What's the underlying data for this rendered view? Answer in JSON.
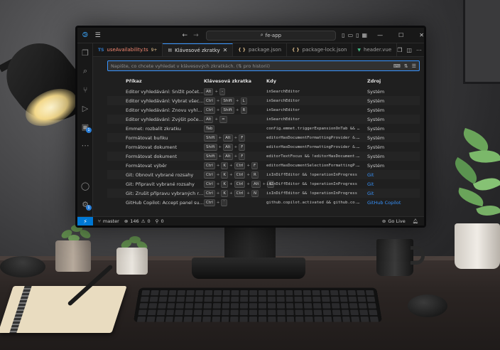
{
  "titlebar": {
    "search_text": "fe-app",
    "search_icon": "search-icon"
  },
  "tabs": [
    {
      "label": "useAvailability.ts",
      "icon": "TS",
      "icon_color": "#3178c6",
      "modified": "9+",
      "active": false,
      "color": "#f48771"
    },
    {
      "label": "Klávesové zkratky",
      "icon": "keyboard-icon",
      "active": true
    },
    {
      "label": "package.json",
      "icon": "{ }",
      "icon_color": "#e2c08d",
      "active": false
    },
    {
      "label": "package-lock.json",
      "icon": "{ }",
      "icon_color": "#e2c08d",
      "active": false
    },
    {
      "label": "header.vue",
      "icon": "vue-icon",
      "icon_color": "#42b883",
      "active": false
    }
  ],
  "keybindings": {
    "search_placeholder": "Napište, co chcete vyhledat v klávesových zkratkách. (⇅ pro historii)",
    "columns": {
      "command": "Příkaz",
      "keybinding": "Klávesová zkratka",
      "when": "Kdy",
      "source": "Zdroj"
    },
    "rows": [
      {
        "command": "Editor vyhledávání: Snížit počet řádků k...",
        "keys": [
          "Alt",
          "-"
        ],
        "when": "inSearchEditor",
        "source": "Systém",
        "ext": false
      },
      {
        "command": "Editor vyhledávání: Vybrat všechny shody",
        "keys": [
          "Ctrl",
          "Shift",
          "L"
        ],
        "when": "inSearchEditor",
        "source": "Systém",
        "ext": false
      },
      {
        "command": "Editor vyhledávání: Znovu vyhledat",
        "keys": [
          "Ctrl",
          "Shift",
          "R"
        ],
        "when": "inSearchEditor",
        "source": "Systém",
        "ext": false
      },
      {
        "command": "Editor vyhledávání: Zvýšit počet řádků k...",
        "keys": [
          "Alt",
          "="
        ],
        "when": "inSearchEditor",
        "source": "Systém",
        "ext": false
      },
      {
        "command": "Emmet: rozbalit zkratku",
        "keys": [
          "Tab"
        ],
        "when": "config.emmet.triggerExpansionOnTab && ...",
        "source": "Systém",
        "ext": false
      },
      {
        "command": "Formátovat buňku",
        "keys": [
          "Shift",
          "Alt",
          "F"
        ],
        "when": "editorHasDocumentFormattingProvider &...",
        "source": "Systém",
        "ext": false
      },
      {
        "command": "Formátovat dokument",
        "keys": [
          "Shift",
          "Alt",
          "F"
        ],
        "when": "editorHasDocumentFormattingProvider &...",
        "source": "Systém",
        "ext": false
      },
      {
        "command": "Formátovat dokument",
        "keys": [
          "Shift",
          "Alt",
          "F"
        ],
        "when": "editorTextFocus && !editorHasDocument...",
        "source": "Systém",
        "ext": false
      },
      {
        "command": "Formátovat výběr",
        "keys": [
          "Ctrl",
          "K",
          "Ctrl",
          "F"
        ],
        "when": "editorHasDocumentSelectionFormattingP...",
        "source": "Systém",
        "ext": false
      },
      {
        "command": "Git: Obnovit vybrané rozsahy",
        "keys": [
          "Ctrl",
          "K",
          "Ctrl",
          "R"
        ],
        "when": "isInDiffEditor && !operationInProgress",
        "source": "Git",
        "ext": true
      },
      {
        "command": "Git: Připravit vybrané rozsahy",
        "keys": [
          "Ctrl",
          "K",
          "Ctrl",
          "Alt",
          "S"
        ],
        "when": "isInDiffEditor && !operationInProgress",
        "source": "Git",
        "ext": true
      },
      {
        "command": "Git: Zrušit přípravu vybraných rozsahů",
        "keys": [
          "Ctrl",
          "K",
          "Ctrl",
          "N"
        ],
        "when": "isInDiffEditor && !operationInProgress",
        "source": "Git",
        "ext": true
      },
      {
        "command": "GitHub Copilot: Accept panel suggestio...",
        "keys": [
          "Ctrl",
          "`"
        ],
        "when": "github.copilot.activated && github.co...",
        "source": "GitHub Copilot",
        "ext": true
      }
    ]
  },
  "activitybar": {
    "icons": [
      "files-icon",
      "search-icon",
      "source-control-icon",
      "run-debug-icon",
      "extensions-icon",
      "more-icon"
    ],
    "extensions_badge": "1",
    "bottom": [
      "account-icon",
      "settings-gear-icon"
    ],
    "settings_badge": "1"
  },
  "statusbar": {
    "branch": "master",
    "errors": "146",
    "warnings": "0",
    "ports": "0",
    "go_live": "Go Live"
  },
  "colors": {
    "accent": "#0078d4",
    "focus": "#3794ff"
  }
}
